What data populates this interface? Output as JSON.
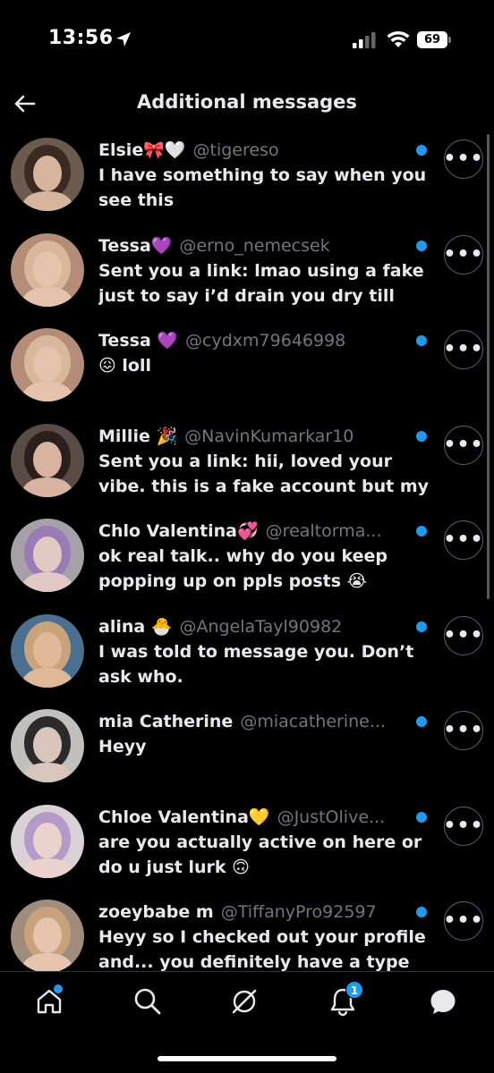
{
  "status_bar": {
    "time": "13:56",
    "battery": "69"
  },
  "header": {
    "title": "Additional messages"
  },
  "messages": [
    {
      "name": "Elsie🎀🤍",
      "handle": "@tigereso",
      "preview": "I have something to say when you see this",
      "avatar_bg": "#6b5a4e",
      "avatar_hair": "#3a2a22",
      "avatar_skin": "#d7b49c"
    },
    {
      "name": "Tessa💜",
      "handle": "@erno_nemecsek",
      "preview": "Sent you a link: lmao using a fake just to say i’d drain you dry till",
      "avatar_bg": "#b48c78",
      "avatar_hair": "#d9b79a",
      "avatar_skin": "#e5c2ac"
    },
    {
      "name": "Tessa 💜",
      "handle": "@cydxm79646998",
      "preview": "😖 loll",
      "avatar_bg": "#b48c78",
      "avatar_hair": "#d9b79a",
      "avatar_skin": "#e5c2ac"
    },
    {
      "name": "Millie 🎉",
      "handle": "@NavinKumarkar10",
      "preview": "Sent you a link: hii, loved your vibe. this is a fake account but my",
      "avatar_bg": "#5a4b44",
      "avatar_hair": "#2a1f1c",
      "avatar_skin": "#d8b3a0"
    },
    {
      "name": "Chlo Valentina💞",
      "handle": "@realtorma...",
      "preview": "ok real talk.. why do you keep popping up on ppls posts 😭",
      "avatar_bg": "#a6a0a8",
      "avatar_hair": "#9b7bb5",
      "avatar_skin": "#e3c9c4"
    },
    {
      "name": "alina 🐣",
      "handle": "@AngelaTayl90982",
      "preview": "I was told to message you. Don’t ask who.",
      "avatar_bg": "#4a6f8f",
      "avatar_hair": "#c9a47a",
      "avatar_skin": "#e0b999"
    },
    {
      "name": "mia Catherine",
      "handle": "@miacatherine...",
      "preview": "Heyy",
      "avatar_bg": "#c2c0bd",
      "avatar_hair": "#2b2b2b",
      "avatar_skin": "#d8c6bd"
    },
    {
      "name": "Chloe Valentina💛",
      "handle": "@JustOlive...",
      "preview": "are you actually active on here or do u just lurk 🙃",
      "avatar_bg": "#d9d1d6",
      "avatar_hair": "#b39ac9",
      "avatar_skin": "#ecd2cc"
    },
    {
      "name": "zoeybabe m",
      "handle": "@TiffanyPro92597",
      "preview": "Heyy so I checked out your profile and... you definitely have a type",
      "avatar_bg": "#a08c7c",
      "avatar_hair": "#c8a27a",
      "avatar_skin": "#e6c4ae"
    }
  ],
  "more_label": "•••",
  "bottom_nav": {
    "notifications_count": "1"
  },
  "colors": {
    "accent": "#1d9bf0",
    "background": "#000000",
    "secondary_text": "#71767b"
  }
}
